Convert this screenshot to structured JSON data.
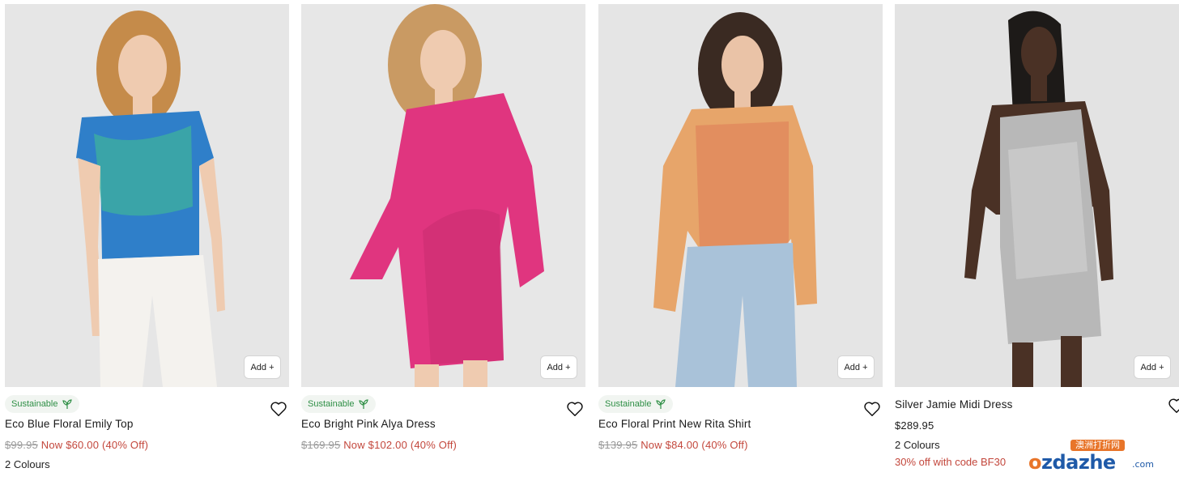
{
  "products": [
    {
      "badge": "Sustainable",
      "title": "Eco Blue Floral Emily Top",
      "old_price": "$99.95",
      "now_price": "Now $60.00 (40% Off)",
      "colours": "2 Colours",
      "add_label": "Add +",
      "bg": "#e6e6e6",
      "garment": "#2f7fc9"
    },
    {
      "badge": "Sustainable",
      "title": "Eco Bright Pink Alya Dress",
      "old_price": "$169.95",
      "now_price": "Now $102.00 (40% Off)",
      "add_label": "Add +",
      "bg": "#e7e7e7",
      "garment": "#e0357f"
    },
    {
      "badge": "Sustainable",
      "title": "Eco Floral Print New Rita Shirt",
      "old_price": "$139.95",
      "now_price": "Now $84.00 (40% Off)",
      "add_label": "Add +",
      "bg": "#e5e5e5",
      "garment": "#e7a56a"
    },
    {
      "title": "Silver Jamie Midi Dress",
      "price": "$289.95",
      "colours": "2 Colours",
      "promo": "30% off with code BF30",
      "add_label": "Add +",
      "bg": "#e3e3e3",
      "garment": "#b8b8b8"
    }
  ],
  "watermark": {
    "tagline": "澳洲打折网",
    "brand_o": "o",
    "brand_rest": "zdazhe",
    "suffix": ".com"
  },
  "colors": {
    "sale_red": "#c3473c",
    "sustainable_green": "#2f8f46",
    "strike_grey": "#9a9a9a"
  }
}
